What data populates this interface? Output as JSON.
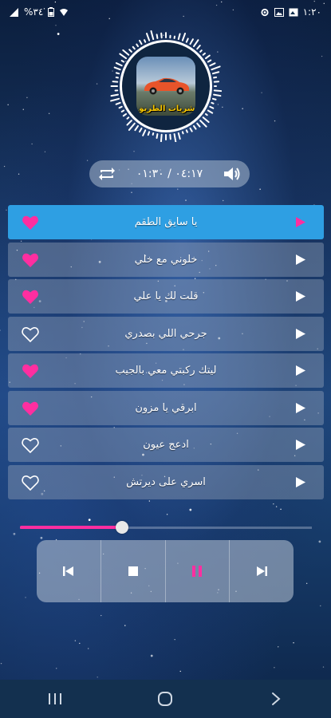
{
  "status_bar": {
    "time": "١:٢٠",
    "battery": "%٣٤",
    "icons": [
      "gallery-icon",
      "photo-icon",
      "settings-icon",
      "wifi-icon",
      "signal-icon",
      "battery-icon"
    ]
  },
  "album": {
    "caption": "شريات الطريق"
  },
  "player": {
    "current_time": "٠١:٣٠",
    "separator": "/",
    "total_time": "٠٤:١٧",
    "progress_fraction": 0.35
  },
  "colors": {
    "accent_pink": "#ff2ea0",
    "active_row": "#2e9fe3"
  },
  "songs": [
    {
      "title": "يا سايق الطقم",
      "favorite": true,
      "active": true
    },
    {
      "title": "خلوني مع خلي",
      "favorite": true,
      "active": false
    },
    {
      "title": "قلت لك يا علي",
      "favorite": true,
      "active": false
    },
    {
      "title": "جرحي اللي بصدري",
      "favorite": false,
      "active": false
    },
    {
      "title": "ليتك ركبتي معي بالجيب",
      "favorite": true,
      "active": false
    },
    {
      "title": "ابرقي يا مزون",
      "favorite": true,
      "active": false
    },
    {
      "title": "ادعج عيون",
      "favorite": false,
      "active": false
    },
    {
      "title": "اسري على ديرتش",
      "favorite": false,
      "active": false
    }
  ],
  "controls": [
    "previous-icon",
    "stop-icon",
    "pause-icon",
    "next-icon"
  ],
  "nav": [
    "recent-apps-icon",
    "home-icon",
    "back-icon"
  ]
}
